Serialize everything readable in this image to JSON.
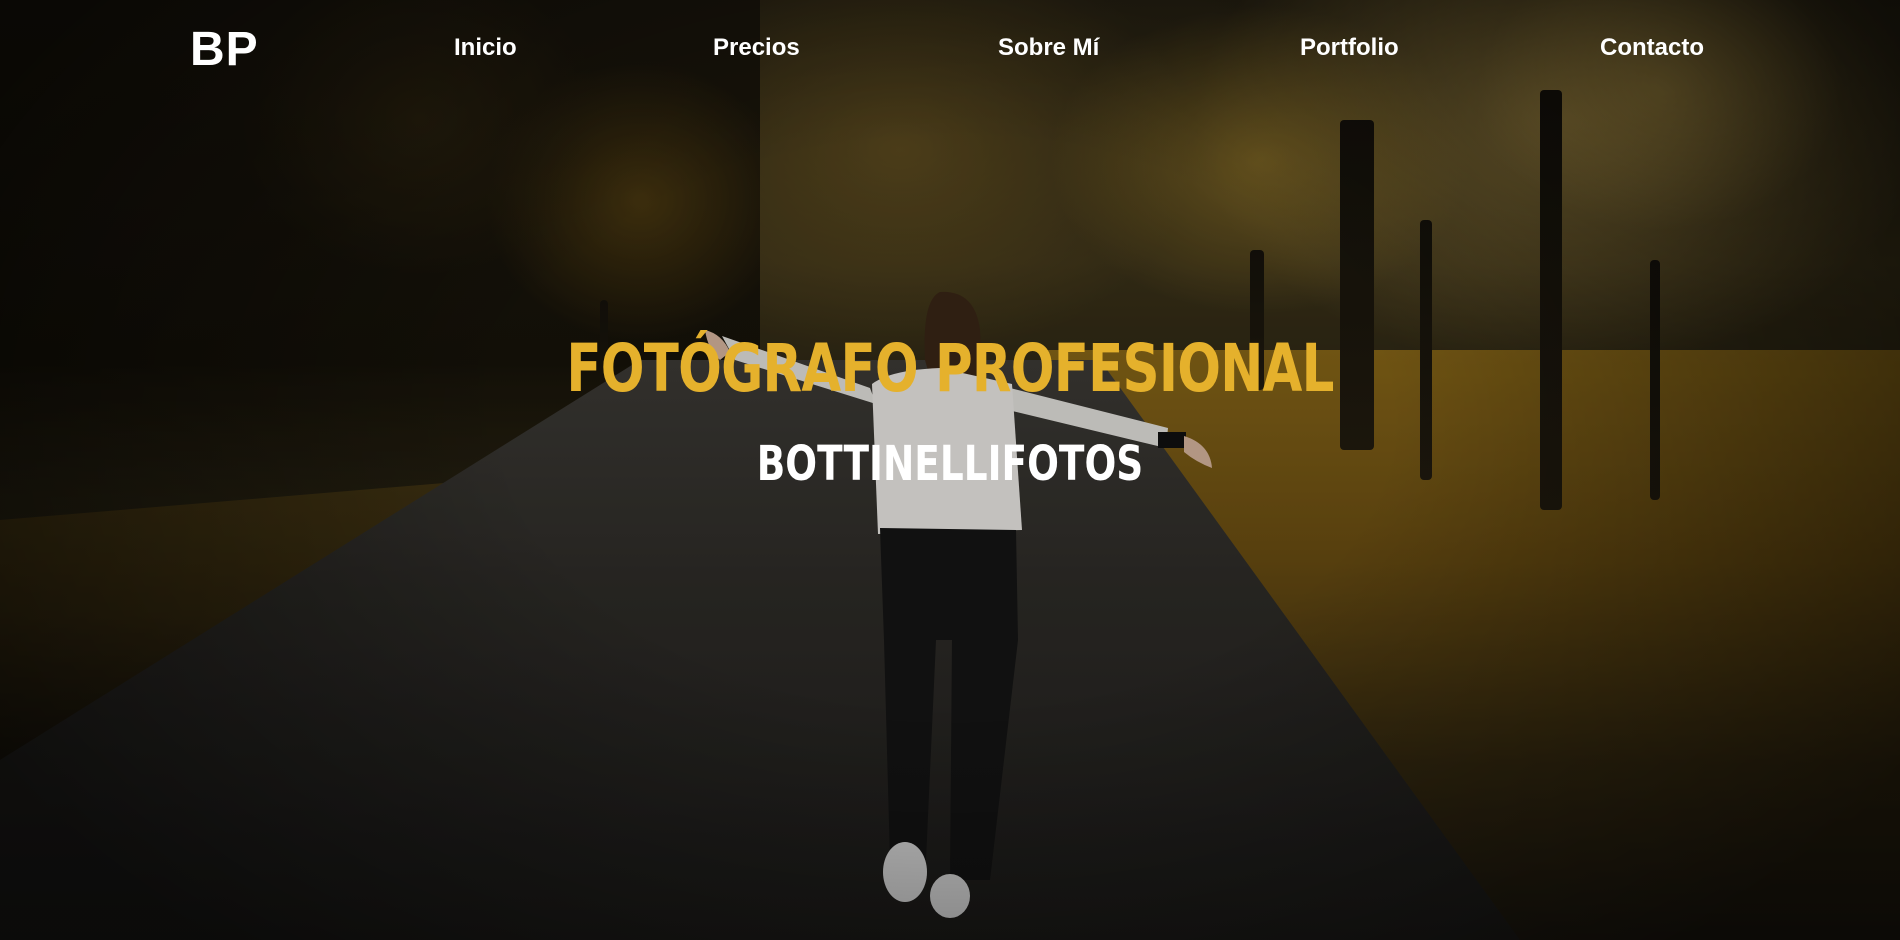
{
  "nav": {
    "logo": "BP",
    "links": [
      {
        "label": "Inicio"
      },
      {
        "label": "Precios"
      },
      {
        "label": "Sobre Mí"
      },
      {
        "label": "Portfolio"
      },
      {
        "label": "Contacto"
      }
    ]
  },
  "hero": {
    "title": "FOTÓGRAFO PROFESIONAL",
    "subtitle": "BOTTINELLIFOTOS",
    "background_image": "woman-with-arms-outstretched-on-autumn-forest-road",
    "colors": {
      "title": "#e5b12c",
      "subtitle": "#ffffff",
      "nav_text": "#ffffff"
    }
  }
}
